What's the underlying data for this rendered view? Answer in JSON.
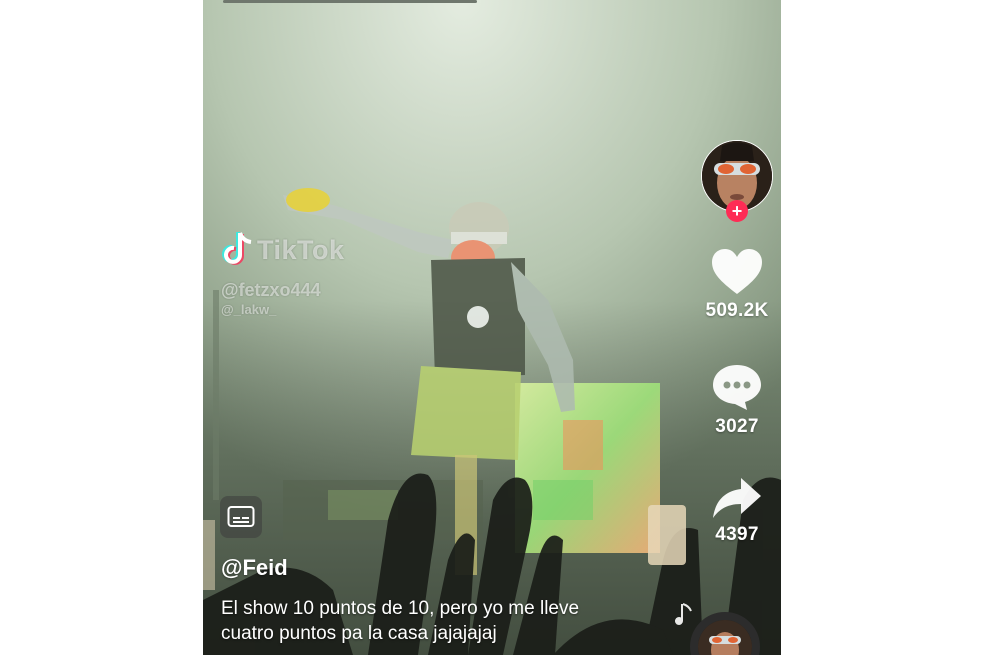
{
  "watermark": {
    "brand": "TikTok",
    "user_primary": "@fetzxo444",
    "user_secondary": "@_lakw_"
  },
  "creator": {
    "username": "@Feid",
    "follow_symbol": "+"
  },
  "actions": {
    "likes": "509.2K",
    "comments": "3027",
    "shares": "4397"
  },
  "caption": {
    "line1": "El show 10 puntos de 10, pero yo me lleve",
    "line2": "cuatro puntos pa la casa jajajajaj"
  },
  "icons": {
    "follow": "plus-icon",
    "like": "heart-icon",
    "comment": "comment-bubble-icon",
    "share": "share-arrow-icon",
    "captions": "closed-captions-icon",
    "music": "music-note-icon",
    "brand": "tiktok-logo-icon"
  },
  "colors": {
    "follow_accent": "#fe2c55",
    "text": "#ffffff"
  }
}
